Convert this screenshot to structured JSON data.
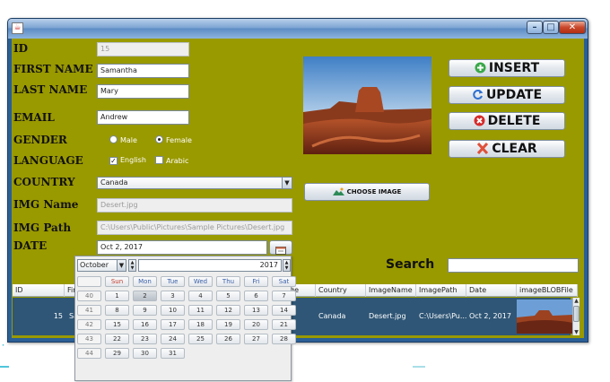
{
  "form": {
    "labels": {
      "id": "ID",
      "first_name": "FIRST NAME",
      "last_name": "LAST NAME",
      "email": "EMAIL",
      "gender": "GENDER",
      "language": "LANGUAGE",
      "country": "COUNTRY",
      "img_name": "IMG Name",
      "img_path": "IMG Path",
      "date": "DATE"
    },
    "values": {
      "id": "15",
      "first_name": "Samantha",
      "last_name": "Mary",
      "email": "Andrew",
      "country": "Canada",
      "img_name": "Desert.jpg",
      "img_path": "C:\\Users\\Public\\Pictures\\Sample Pictures\\Desert.jpg",
      "date": "Oct 2, 2017"
    },
    "gender": {
      "male": "Male",
      "female": "Female",
      "selected": "Female"
    },
    "language": {
      "english": "English",
      "arabic": "Arabic",
      "english_checked": true,
      "arabic_checked": false
    }
  },
  "buttons": {
    "insert": "INSERT",
    "update": "UPDATE",
    "delete": "DELETE",
    "clear": "CLEAR",
    "choose_image": "CHOOSE IMAGE"
  },
  "search": {
    "label": "Search",
    "value": ""
  },
  "table": {
    "columns": [
      "ID",
      "Fir",
      "ge",
      "Country",
      "ImageName",
      "ImagePath",
      "Date",
      "imageBLOBFile"
    ],
    "rows": [
      {
        "id": "15",
        "first": "Sa",
        "country": "Canada",
        "image_name": "Desert.jpg",
        "image_path": "C:\\Users\\Pu...",
        "date": "Oct 2, 2017"
      }
    ]
  },
  "calendar": {
    "month": "October",
    "year": "2017",
    "weekdays": [
      "Sun",
      "Mon",
      "Tue",
      "Wed",
      "Thu",
      "Fri",
      "Sat"
    ],
    "weeks": [
      {
        "week": "40",
        "days": [
          "1",
          "2",
          "3",
          "4",
          "5",
          "6",
          "7"
        ]
      },
      {
        "week": "41",
        "days": [
          "8",
          "9",
          "10",
          "11",
          "12",
          "13",
          "14"
        ]
      },
      {
        "week": "42",
        "days": [
          "15",
          "16",
          "17",
          "18",
          "19",
          "20",
          "21"
        ]
      },
      {
        "week": "43",
        "days": [
          "22",
          "23",
          "24",
          "25",
          "26",
          "27",
          "28"
        ]
      },
      {
        "week": "44",
        "days": [
          "29",
          "30",
          "31"
        ]
      }
    ],
    "selected_day": "2"
  },
  "colors": {
    "form_background": "#999900",
    "window_frame": "#2a5f96",
    "selected_row": "#2f5676",
    "insert_icon": "#3aa84a",
    "update_icon": "#2f6fd0",
    "delete_icon": "#d62b2b",
    "clear_icon": "#e0503a"
  },
  "icons": {
    "insert": "plus-circle-icon",
    "update": "refresh-icon",
    "delete": "x-circle-icon",
    "clear": "x-icon",
    "choose_image": "image-icon",
    "date_picker": "calendar-icon"
  }
}
